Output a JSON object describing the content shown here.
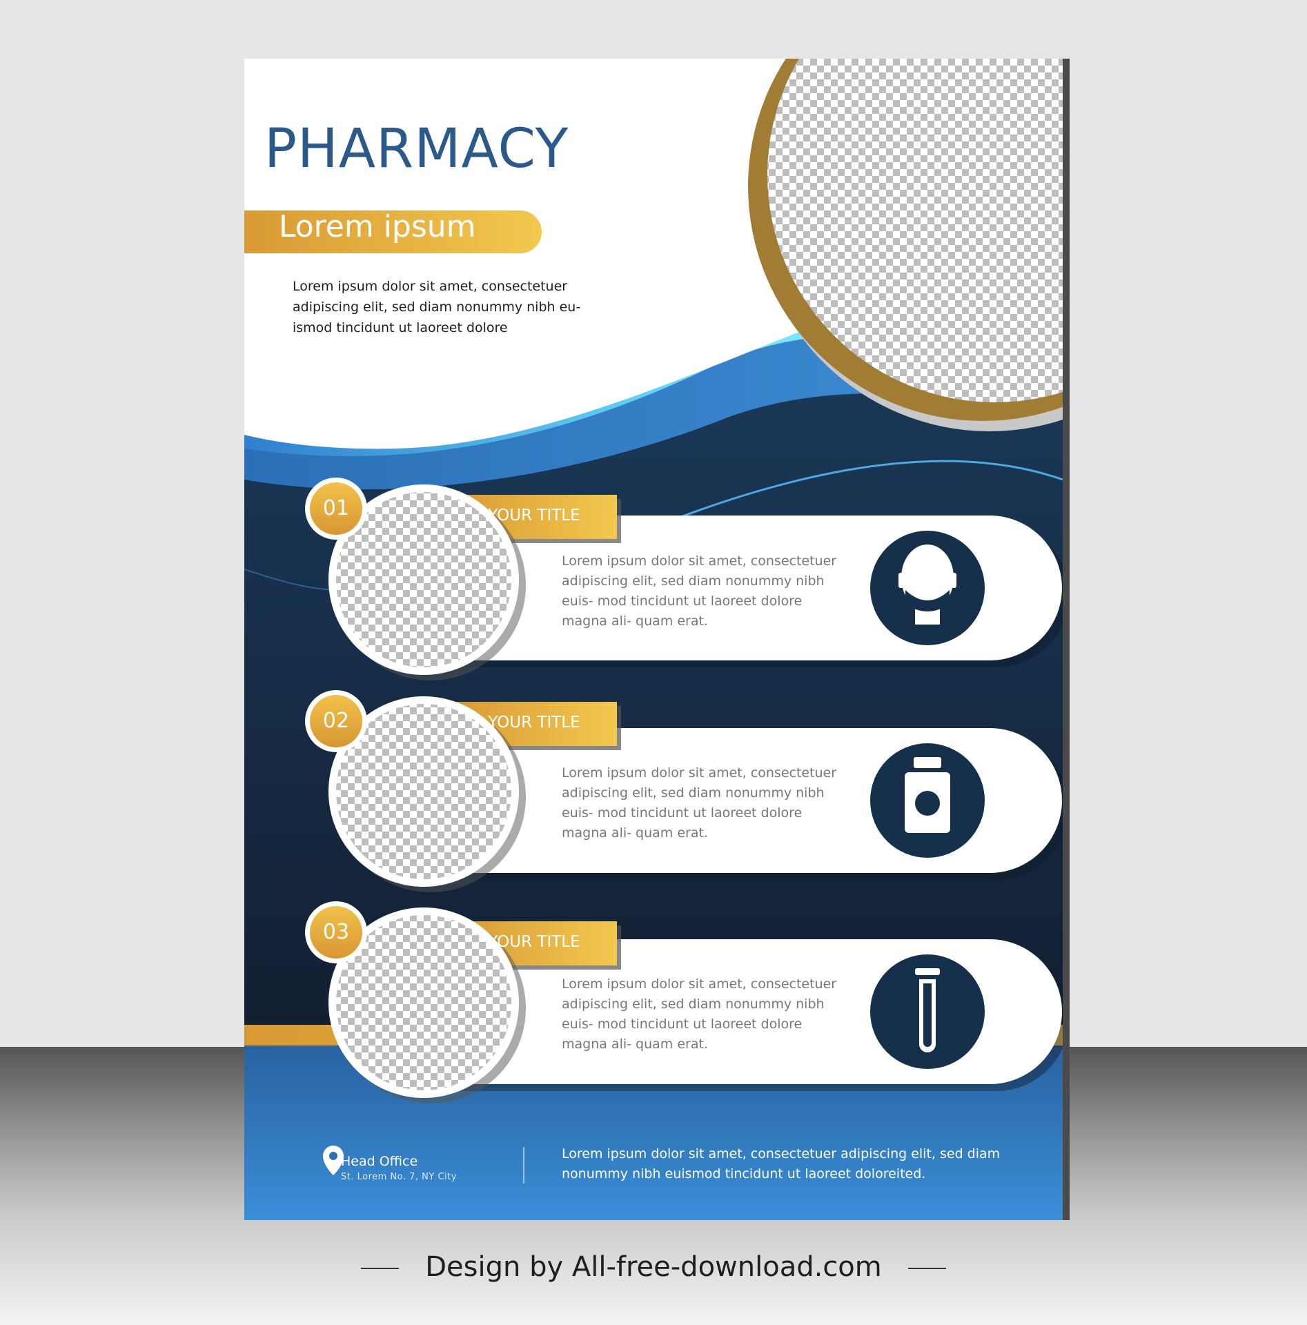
{
  "flyer": {
    "title": "PHARMACY",
    "subtitle": "Lorem ipsum",
    "intro": "Lorem ipsum dolor sit amet, consectetuer adipiscing elit, sed diam nonummy nibh eu- ismod tincidunt ut laoreet dolore"
  },
  "items": [
    {
      "number": "01",
      "title": "YOUR TITLE",
      "text": "Lorem ipsum dolor sit amet, consectetuer adipiscing elit, sed diam nonummy nibh euis- mod tincidunt ut laoreet dolore magna ali- quam erat.",
      "icon": "masked-face-icon"
    },
    {
      "number": "02",
      "title": "YOUR TITLE",
      "text": "Lorem ipsum dolor sit amet, consectetuer adipiscing elit, sed diam nonummy nibh euis- mod tincidunt ut laoreet dolore magna ali- quam erat.",
      "icon": "medicine-bottle-icon"
    },
    {
      "number": "03",
      "title": "YOUR TITLE",
      "text": "Lorem ipsum dolor sit amet, consectetuer adipiscing elit, sed diam nonummy nibh euis- mod tincidunt ut laoreet dolore magna ali- quam erat.",
      "icon": "test-tube-icon"
    }
  ],
  "footer": {
    "office_title": "Head Office",
    "office_address": "St. Lorem No. 7, NY City",
    "text": "Lorem ipsum dolor sit amet, consectetuer adipiscing elit, sed diam nonummy nibh euismod tincidunt ut laoreet doloreited.",
    "location_icon": "location-pin-icon"
  },
  "credit": "Design by All-free-download.com",
  "colors": {
    "navy": "#16304c",
    "blue": "#2f6fae",
    "light_blue": "#5fd0f3",
    "gold": "#e8b23d",
    "bronze": "#a17c35",
    "title_blue": "#2b5a8a"
  }
}
